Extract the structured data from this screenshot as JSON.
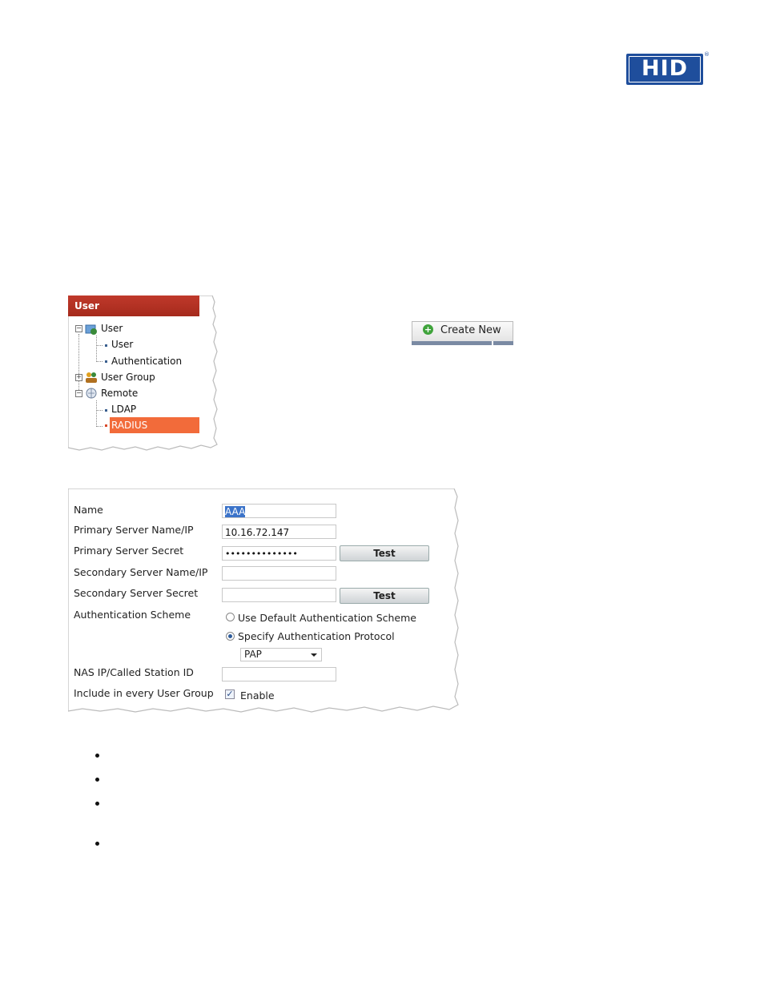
{
  "logo": {
    "text": "HID",
    "registered": "®"
  },
  "tree": {
    "header": "User",
    "nodes": [
      {
        "label": "User"
      },
      {
        "label": "User"
      },
      {
        "label": "Authentication"
      },
      {
        "label": "User Group"
      },
      {
        "label": "Remote"
      },
      {
        "label": "LDAP"
      },
      {
        "label": "RADIUS"
      }
    ]
  },
  "create_new": {
    "label": "Create New"
  },
  "form": {
    "fields": {
      "name": {
        "label": "Name",
        "value": "AAA"
      },
      "primary_server": {
        "label": "Primary Server Name/IP",
        "value": "10.16.72.147"
      },
      "primary_secret": {
        "label": "Primary Server Secret",
        "value": "••••••••••••••"
      },
      "secondary_server": {
        "label": "Secondary Server Name/IP",
        "value": ""
      },
      "secondary_secret": {
        "label": "Secondary Server Secret",
        "value": ""
      },
      "auth_scheme": {
        "label": "Authentication Scheme",
        "option_default": "Use Default Authentication Scheme",
        "option_specify": "Specify Authentication Protocol",
        "protocol": "PAP"
      },
      "nas_ip": {
        "label": "NAS IP/Called Station ID",
        "value": ""
      },
      "include_group": {
        "label": "Include in every User Group",
        "checkbox_label": "Enable",
        "checked": true
      }
    },
    "test_label": "Test"
  },
  "colors": {
    "brand": "#1f4e9c",
    "tree_header": "#b03222",
    "selection": "#f26b3a"
  }
}
